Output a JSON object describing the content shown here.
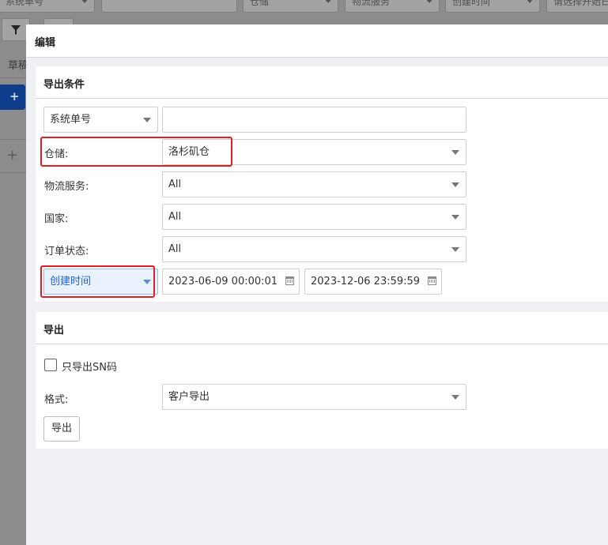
{
  "background": {
    "filters": [
      "系统单号",
      "",
      "仓储",
      "物流服务",
      "创建时间",
      "请选择开始日"
    ],
    "side_labels": [
      "草稿",
      "+",
      "+"
    ]
  },
  "modal": {
    "title": "编辑",
    "export_conditions": {
      "title": "导出条件",
      "search_type": "系统单号",
      "search_value": "",
      "warehouse_label": "仓储:",
      "warehouse_value": "洛杉矶仓",
      "logistics_label": "物流服务:",
      "logistics_value": "All",
      "country_label": "国家:",
      "country_value": "All",
      "order_status_label": "订单状态:",
      "order_status_value": "All",
      "date_type": "创建时间",
      "date_start": "2023-06-09 00:00:01",
      "date_end": "2023-12-06 23:59:59"
    },
    "export": {
      "title": "导出",
      "sn_only_label": "只导出SN码",
      "sn_only_checked": false,
      "format_label": "格式:",
      "format_value": "客户导出",
      "export_button": "导出"
    }
  },
  "colors": {
    "highlight": "#e02020",
    "selected_select_bg": "#e8f1fd",
    "selected_select_text": "#1f62c9",
    "caret_selected": "#5b8fd6"
  }
}
